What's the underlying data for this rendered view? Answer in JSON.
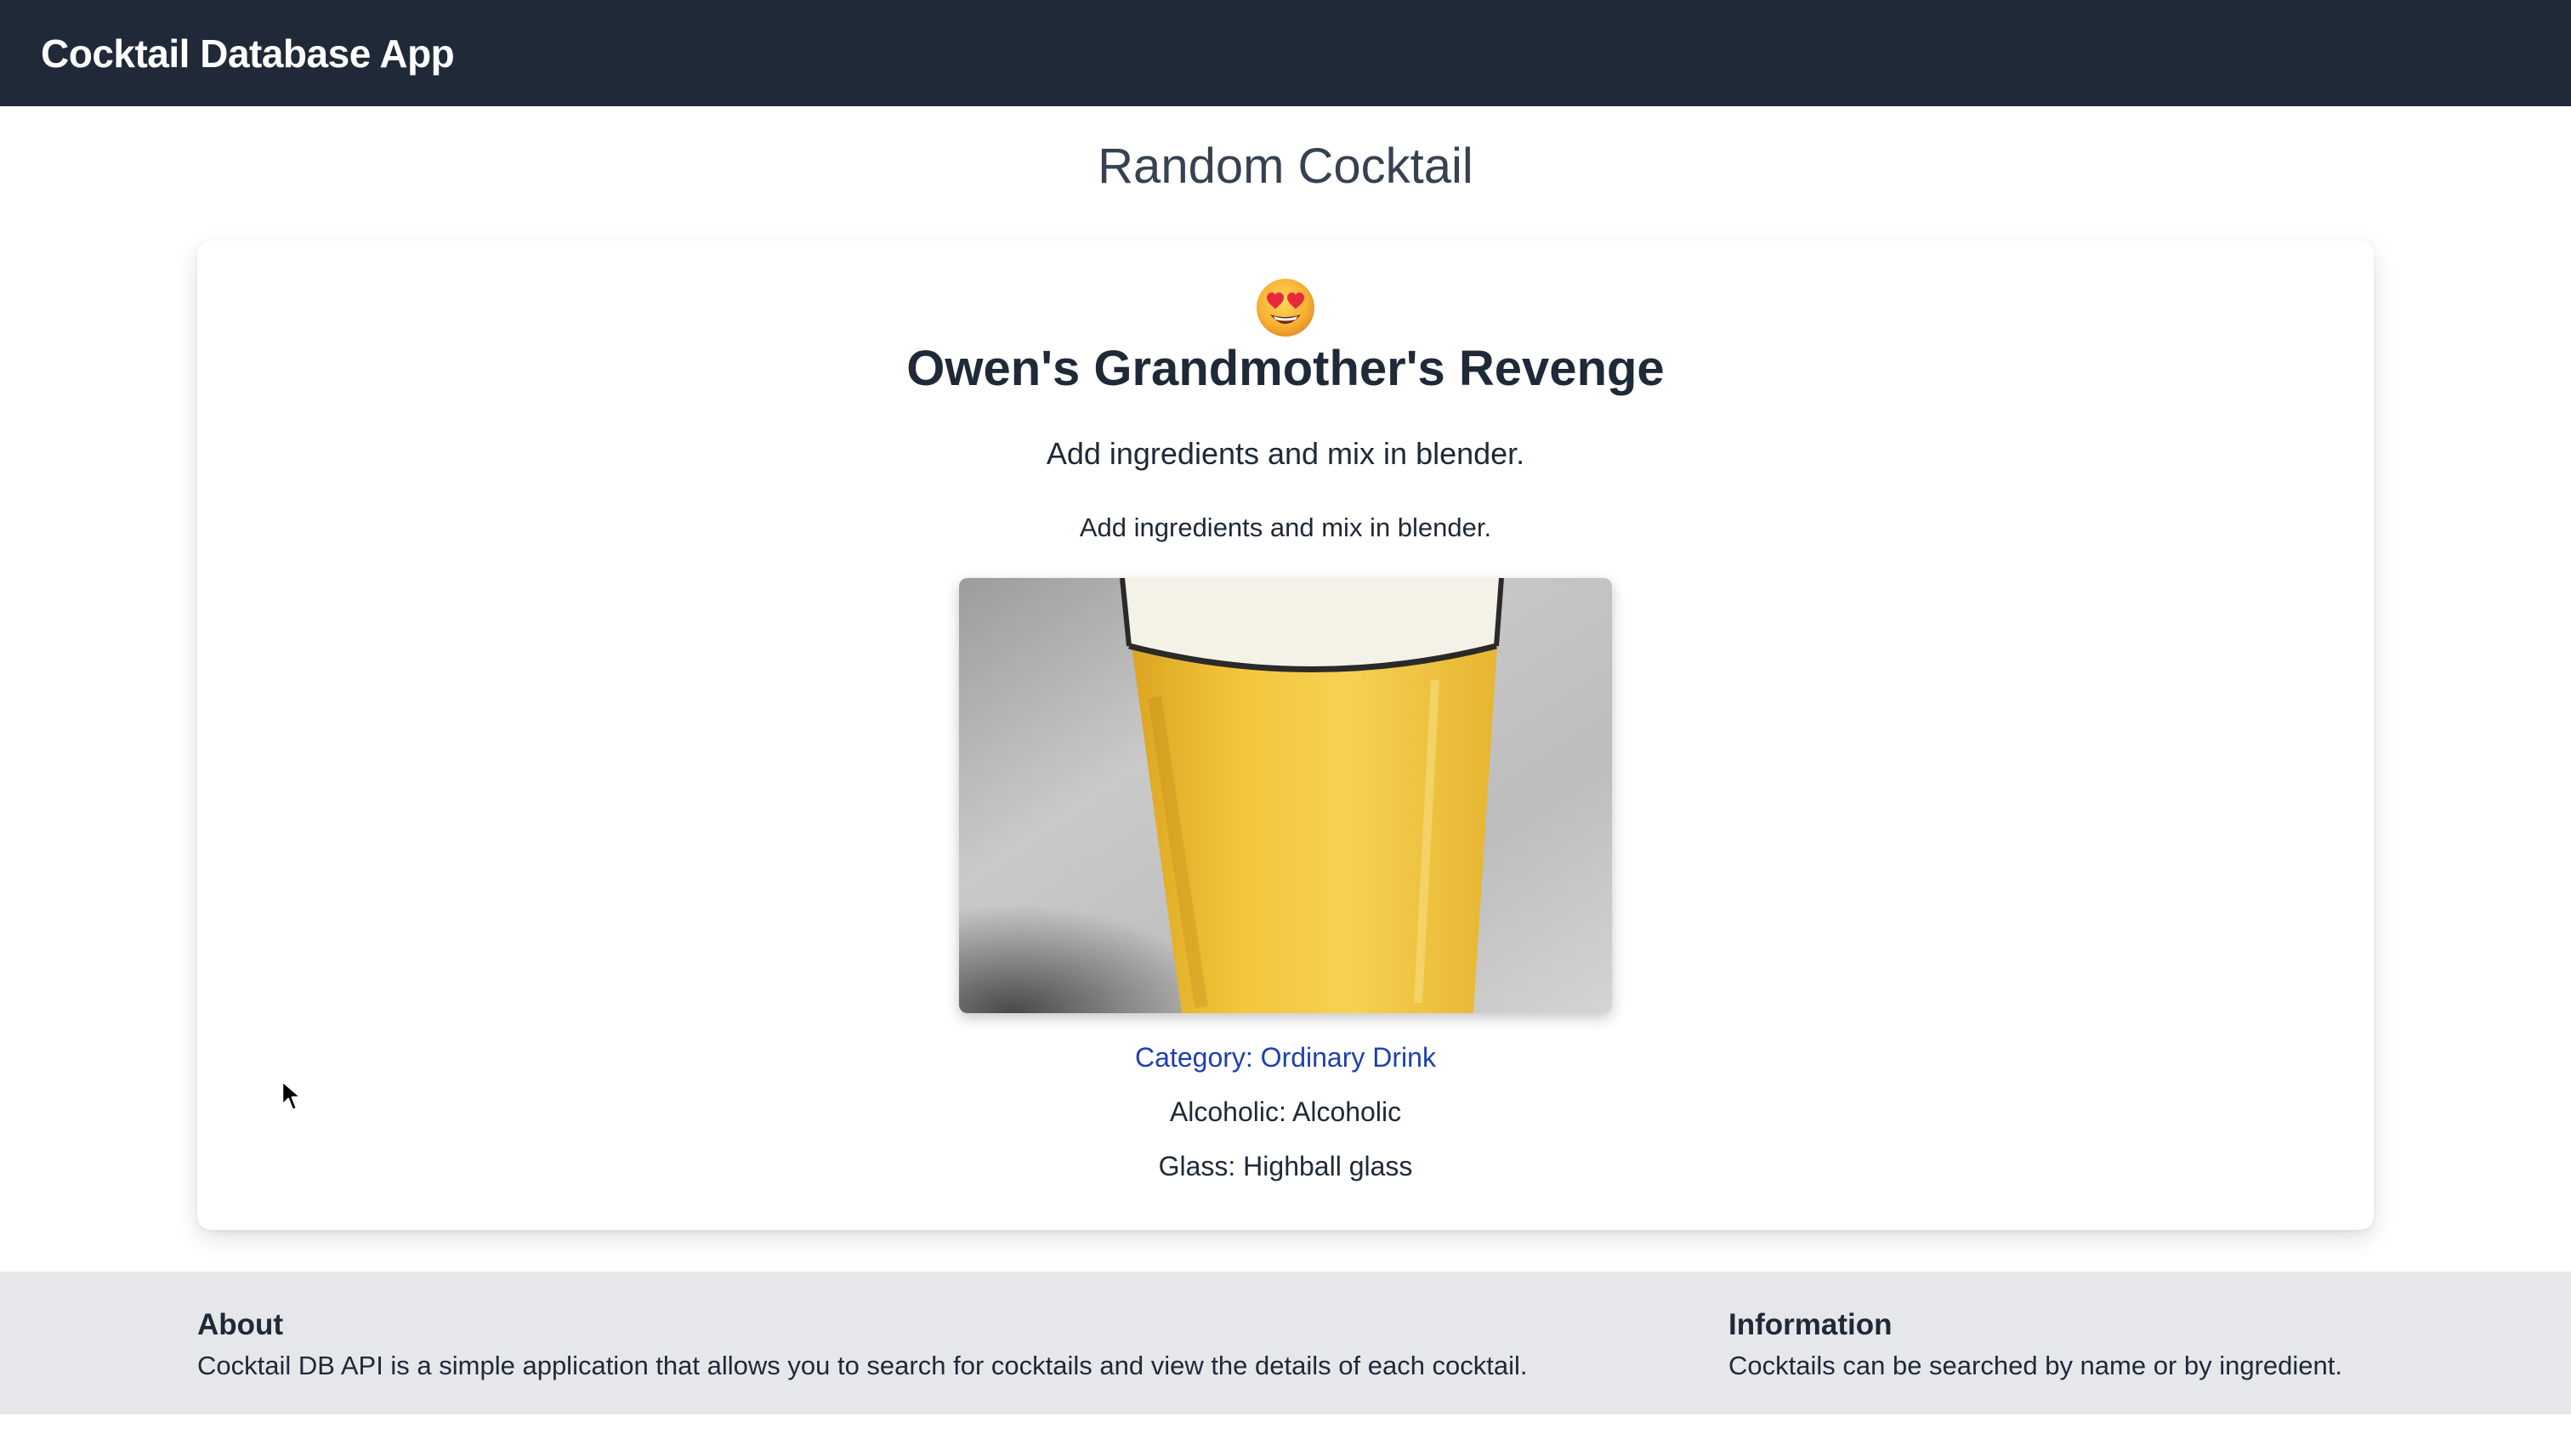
{
  "navbar": {
    "brand": "Cocktail Database App"
  },
  "page": {
    "title": "Random Cocktail"
  },
  "cocktail": {
    "emoji": "😍",
    "name": "Owen's Grandmother's Revenge",
    "instructions_primary": "Add ingredients and mix in blender.",
    "instructions_secondary": "Add ingredients and mix in blender.",
    "image_icon": "beer-glass-photo",
    "category": "Category: Ordinary Drink",
    "alcoholic": "Alcoholic: Alcoholic",
    "glass": "Glass: Highball glass"
  },
  "footer": {
    "about_heading": "About",
    "about_text": "Cocktail DB API is a simple application that allows you to search for cocktails and view the details of each cocktail.",
    "info_heading": "Information",
    "info_text": "Cocktails can be searched by name or by ingredient."
  },
  "colors": {
    "navbar_bg": "#1f2937",
    "footer_bg": "#e5e7eb",
    "link": "#1e40af"
  }
}
